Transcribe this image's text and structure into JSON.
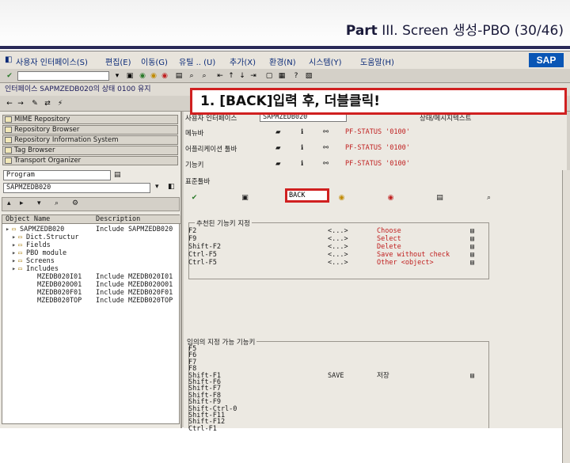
{
  "slide": {
    "title_bold_prefix": "Part",
    "title_rest": " III. Screen 생성-PBO (30/46)"
  },
  "menubar": {
    "items": [
      "사용자 인터페이스(S)",
      "편집(E)",
      "이동(G)",
      "유틸 .. (U)",
      "추가(X)",
      "환경(N)",
      "시스템(Y)",
      "도움말(H)"
    ],
    "logo": "SAP"
  },
  "title_bar": {
    "text": "인터페이스 SAPMZEDB020의 상태 0100 유지"
  },
  "callout": {
    "text": "1. [BACK]입력 후, 더블클릭!"
  },
  "left_pane": {
    "nav": [
      "MIME Repository",
      "Repository Browser",
      "Repository Information System",
      "Tag Browser",
      "Transport Organizer"
    ],
    "object_type": "Program",
    "object_name": "SAPMZEDB020",
    "tree_header": {
      "col1": "Object Name",
      "col2": "Description"
    },
    "tree": [
      {
        "name": "SAPMZEDB020",
        "desc": "Include SAPMZEDB020",
        "indent": 1
      },
      {
        "name": "Dict.Structur",
        "desc": "",
        "indent": 2
      },
      {
        "name": "Fields",
        "desc": "",
        "indent": 2
      },
      {
        "name": "PBO module",
        "desc": "",
        "indent": 2
      },
      {
        "name": "Screens",
        "desc": "",
        "indent": 2
      },
      {
        "name": "Includes",
        "desc": "",
        "indent": 2
      },
      {
        "name": "MZEDB020I01",
        "desc": "Include MZEDB020I01",
        "indent": 3
      },
      {
        "name": "MZEDB020O01",
        "desc": "Include MZEDB020O01",
        "indent": 3
      },
      {
        "name": "MZEDB020F01",
        "desc": "Include MZEDB020F01",
        "indent": 3
      },
      {
        "name": "MZEDB020TOP",
        "desc": "Include MZEDB020TOP",
        "indent": 3
      }
    ]
  },
  "right_pane": {
    "header_label": "사용자 인터페이스",
    "header_value": "SAPMZEDB020",
    "header_right": "상태/메시지텍스트",
    "rows": [
      {
        "label": "메뉴바",
        "status": "PF-STATUS '0100'"
      },
      {
        "label": "어플리케이션 툴바",
        "status": "PF-STATUS '0100'"
      },
      {
        "label": "기능키",
        "status": "PF-STATUS '0100'"
      }
    ],
    "std_toolbar_label": "표준툴바",
    "back_value": "BACK",
    "recommended_title": "추천된 기능키 지정",
    "recommended": [
      {
        "key": "F2",
        "obj": "<...>",
        "text": "Choose"
      },
      {
        "key": "F9",
        "obj": "<...>",
        "text": "Select"
      },
      {
        "key": "Shift-F2",
        "obj": "<...>",
        "text": "Delete"
      },
      {
        "key": "Ctrl-F5",
        "obj": "<...>",
        "text": "Save without check"
      },
      {
        "key": "Ctrl-F5",
        "obj": "<...>",
        "text": "Other <object>"
      }
    ],
    "free_title": "임의의 지정 가능 기능키",
    "free": [
      {
        "key": "F5",
        "code": "",
        "text": ""
      },
      {
        "key": "F6",
        "code": "",
        "text": ""
      },
      {
        "key": "F7",
        "code": "",
        "text": ""
      },
      {
        "key": "F8",
        "code": "",
        "text": ""
      },
      {
        "key": "Shift-F1",
        "code": "SAVE",
        "text": "저장"
      },
      {
        "key": "Shift-F6",
        "code": "",
        "text": ""
      },
      {
        "key": "Shift-F7",
        "code": "",
        "text": ""
      },
      {
        "key": "Shift-F8",
        "code": "",
        "text": ""
      },
      {
        "key": "Shift-F9",
        "code": "",
        "text": ""
      },
      {
        "key": "Shift-Ctrl-0",
        "code": "",
        "text": ""
      },
      {
        "key": "Shift-F11",
        "code": "",
        "text": ""
      },
      {
        "key": "Shift-F12",
        "code": "",
        "text": ""
      },
      {
        "key": "Ctrl-F1",
        "code": "",
        "text": ""
      }
    ]
  },
  "colors": {
    "callout_border": "#d02020",
    "status_text": "#c02020",
    "header_rule": "#2b2b5a",
    "sap_blue": "#0a56b5"
  }
}
